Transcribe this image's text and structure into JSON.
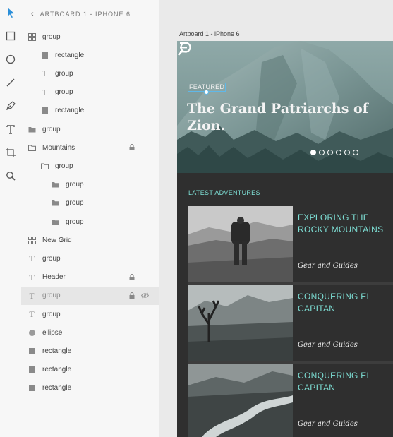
{
  "layers_panel": {
    "breadcrumb": "ARTBOARD 1 - IPHONE 6",
    "items": [
      {
        "label": "group",
        "icon": "grid-icon",
        "indent": 0
      },
      {
        "label": "rectangle",
        "icon": "rectangle-icon",
        "indent": 1
      },
      {
        "label": "group",
        "icon": "text-icon",
        "indent": 1
      },
      {
        "label": "group",
        "icon": "text-icon",
        "indent": 1
      },
      {
        "label": "rectangle",
        "icon": "rectangle-icon",
        "indent": 1
      },
      {
        "label": "group",
        "icon": "folder-icon",
        "indent": 0
      },
      {
        "label": "Mountains",
        "icon": "folder-outline-icon",
        "indent": 0,
        "locked": true
      },
      {
        "label": "group",
        "icon": "folder-outline-icon",
        "indent": 1
      },
      {
        "label": "group",
        "icon": "folder-icon",
        "indent": 2
      },
      {
        "label": "group",
        "icon": "folder-icon",
        "indent": 2
      },
      {
        "label": "group",
        "icon": "folder-icon",
        "indent": 2
      },
      {
        "label": "New Grid",
        "icon": "grid-icon",
        "indent": 0
      },
      {
        "label": "group",
        "icon": "text-icon",
        "indent": 0
      },
      {
        "label": "Header",
        "icon": "text-icon",
        "indent": 0,
        "locked": true
      },
      {
        "label": "group",
        "icon": "text-icon",
        "indent": 0,
        "locked": true,
        "hidden": true,
        "selected": true
      },
      {
        "label": "group",
        "icon": "text-icon",
        "indent": 0
      },
      {
        "label": "ellipse",
        "icon": "ellipse-icon",
        "indent": 0
      },
      {
        "label": "rectangle",
        "icon": "rectangle-icon",
        "indent": 0
      },
      {
        "label": "rectangle",
        "icon": "rectangle-icon",
        "indent": 0
      },
      {
        "label": "rectangle",
        "icon": "rectangle-icon",
        "indent": 0
      }
    ]
  },
  "toolbar": {
    "tools": [
      "select-tool-icon",
      "rectangle-tool-icon",
      "ellipse-tool-icon",
      "line-tool-icon",
      "pen-tool-icon",
      "text-tool-icon",
      "artboard-tool-icon",
      "zoom-tool-icon"
    ]
  },
  "canvas": {
    "artboard_label": "Artboard 1 - iPhone 6"
  },
  "artboard": {
    "featured_label": "FEATURED",
    "hero_title": "The Grand Patriarchs of Zion.",
    "carousel": {
      "count": 6,
      "active": 1
    },
    "section_title": "LATEST ADVENTURES",
    "cards": [
      {
        "title": "EXPLORING THE ROCKY MOUNTAINS",
        "subtitle": "Gear and Guides"
      },
      {
        "title": "CONQUERING EL CAPITAN",
        "subtitle": "Gear and Guides"
      },
      {
        "title": "CONQUERING EL CAPITAN",
        "subtitle": "Gear and Guides"
      }
    ]
  },
  "colors": {
    "accent": "#7ee0d6",
    "selection": "#5fb8e8",
    "tool_active": "#2b8fd9"
  }
}
